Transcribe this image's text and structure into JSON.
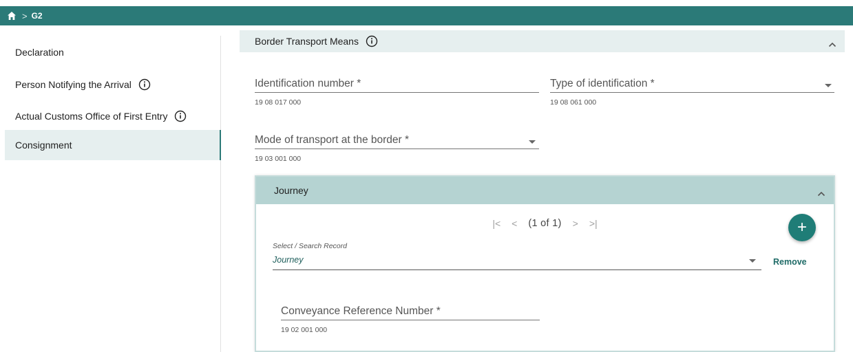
{
  "breadcrumb": {
    "current": "G2",
    "separator": ">"
  },
  "sidebar": {
    "items": [
      {
        "label": "Declaration",
        "info": false
      },
      {
        "label": "Person Notifying the Arrival",
        "info": true
      },
      {
        "label": "Actual Customs Office of First Entry",
        "info": true
      },
      {
        "label": "Consignment",
        "info": false,
        "active": true
      }
    ]
  },
  "section": {
    "title": "Border Transport Means",
    "fields": {
      "identification_number": {
        "label": "Identification number *",
        "code": "19 08 017 000"
      },
      "type_of_identification": {
        "label": "Type of identification *",
        "code": "19 08 061 000"
      },
      "mode_of_transport": {
        "label": "Mode of transport at the border *",
        "code": "19 03 001 000"
      }
    }
  },
  "journey": {
    "title": "Journey",
    "pager": {
      "first": "|<",
      "prev": "<",
      "count": "(1 of 1)",
      "next": ">",
      "last": ">|"
    },
    "select_label": "Select / Search Record",
    "select_value": "Journey",
    "remove_label": "Remove",
    "conveyance": {
      "label": "Conveyance Reference Number *",
      "code": "19 02 001 000"
    }
  },
  "colors": {
    "primary": "#2b7a78",
    "section_bg": "#e6efef",
    "journey_head": "#b5d3d2"
  }
}
